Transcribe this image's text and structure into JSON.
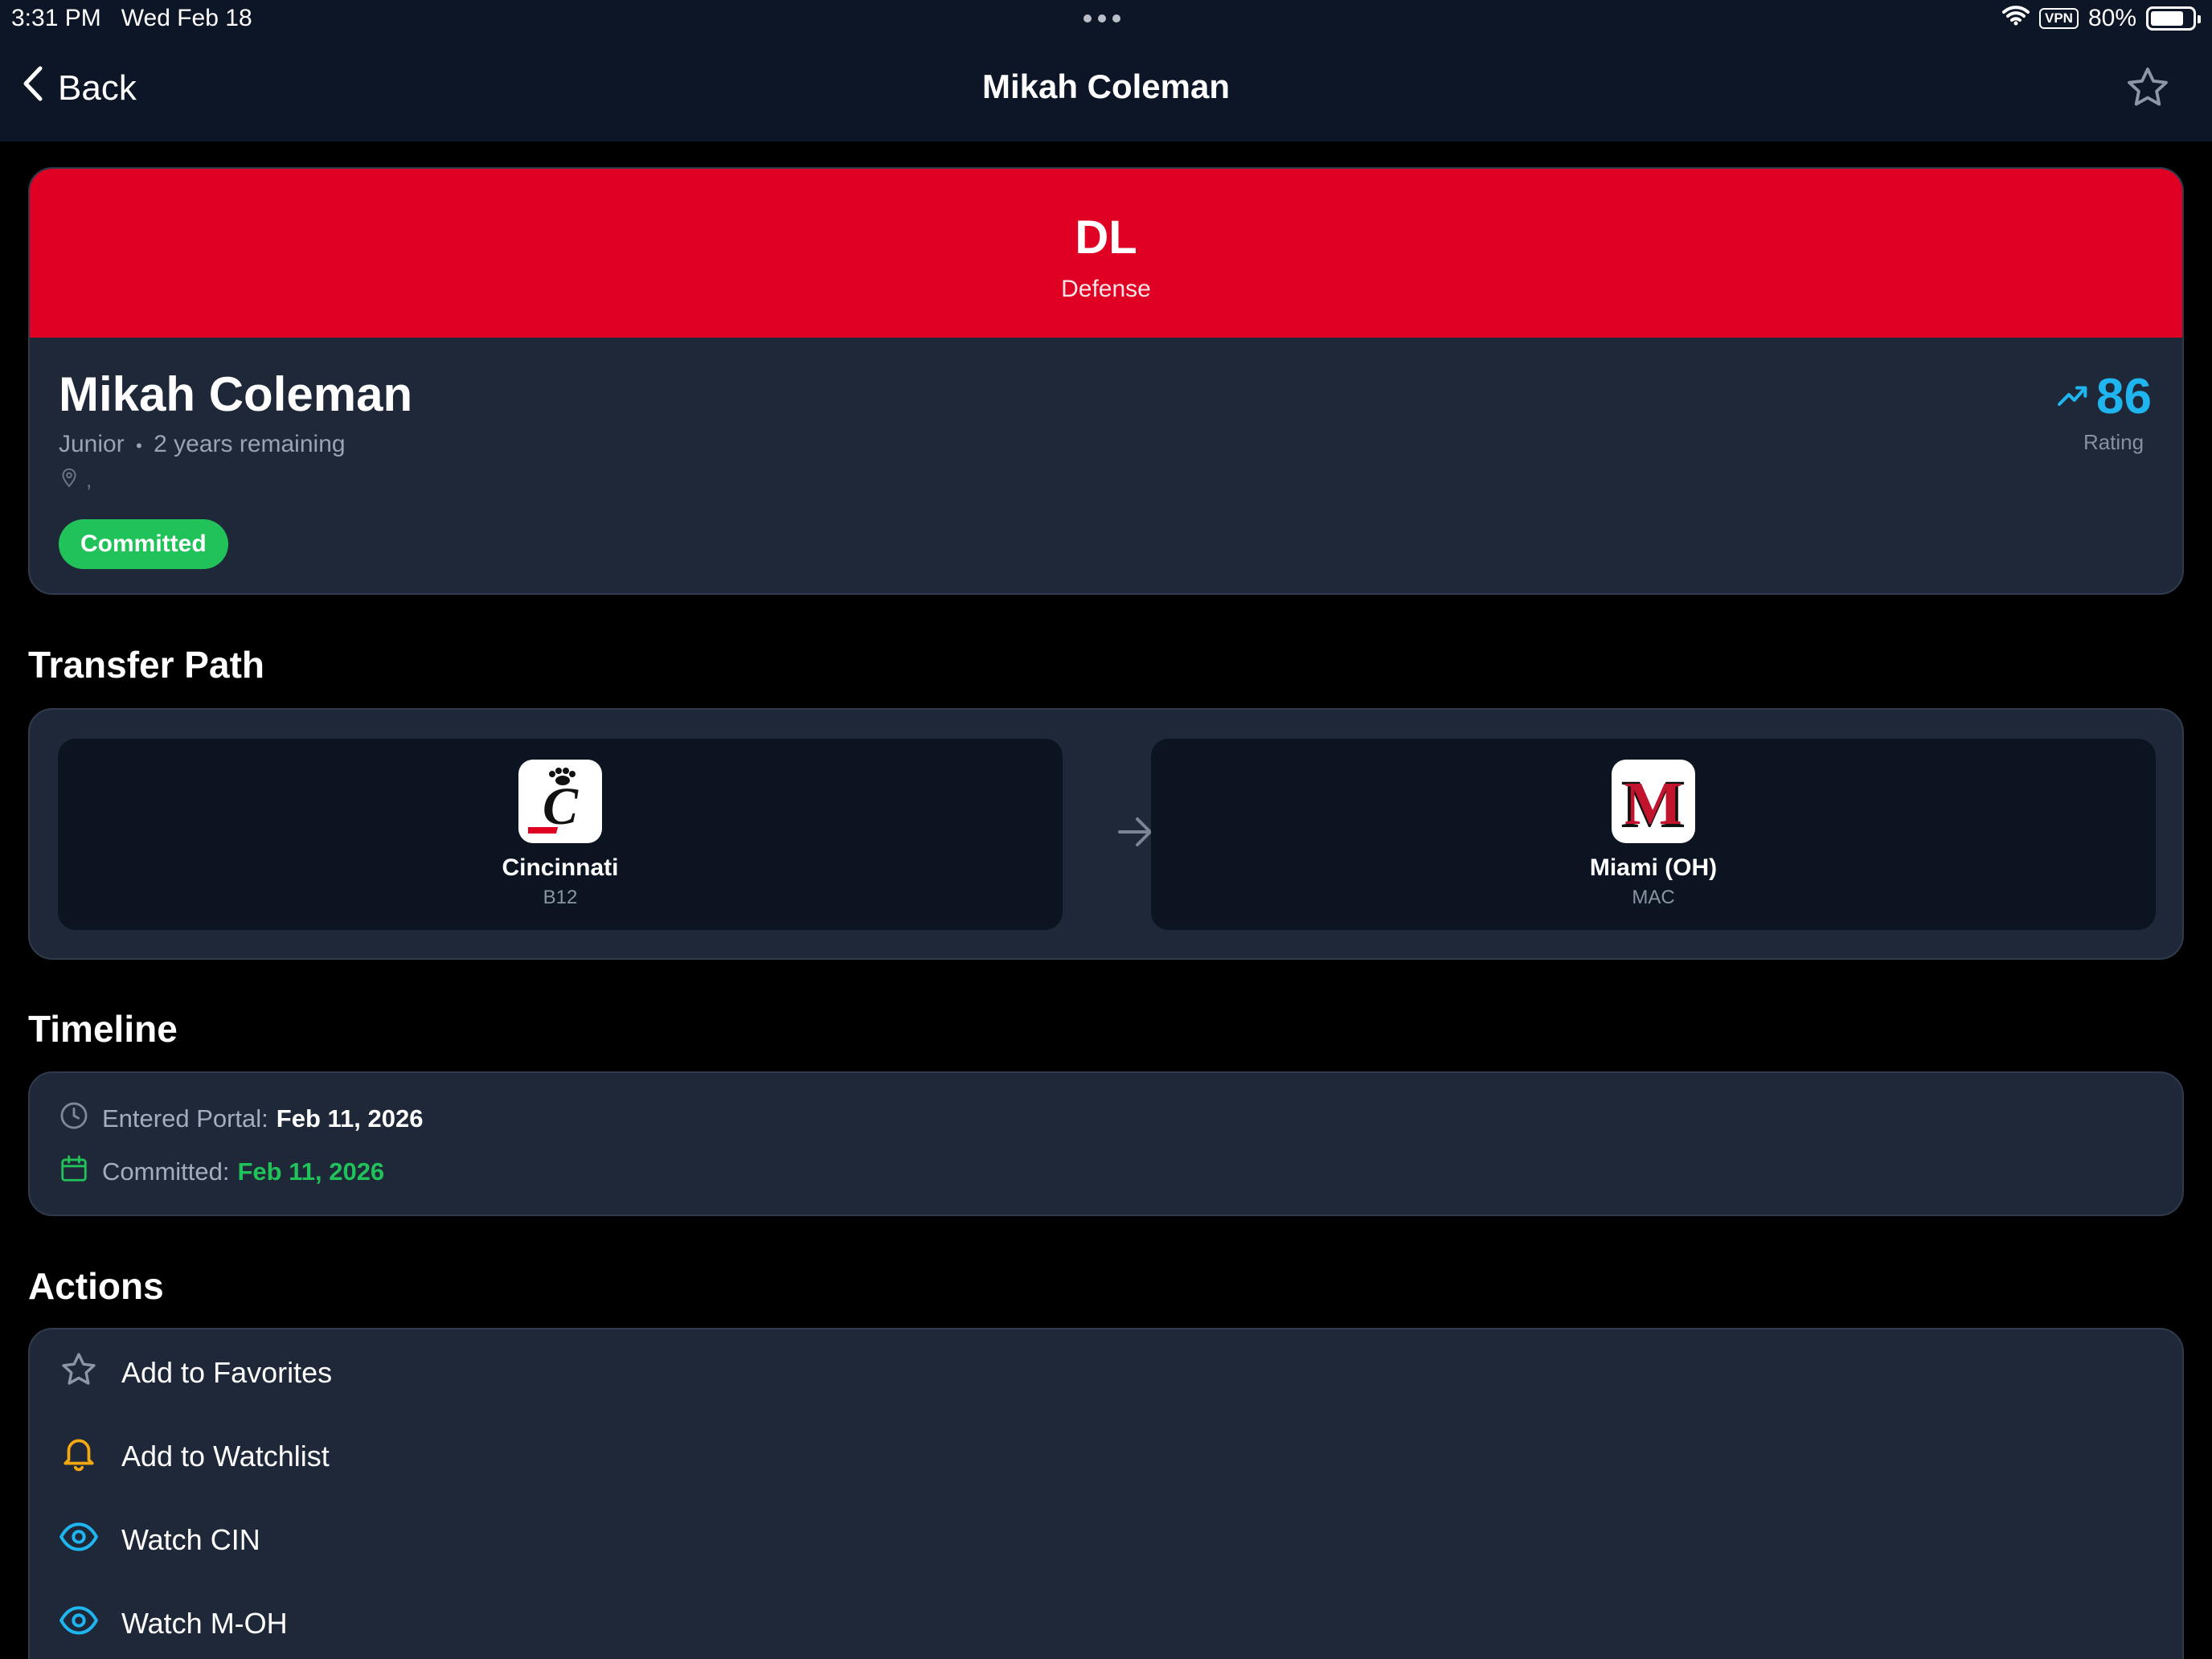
{
  "status_bar": {
    "time": "3:31 PM",
    "date": "Wed Feb 18",
    "vpn": "VPN",
    "battery": "80%",
    "battery_level": 0.8
  },
  "nav": {
    "back_label": "Back",
    "title": "Mikah Coleman"
  },
  "player": {
    "position_code": "DL",
    "position_group": "Defense",
    "name": "Mikah Coleman",
    "class_year": "Junior",
    "separator": "•",
    "eligibility": "2 years remaining",
    "location": ",",
    "status": "Committed",
    "rating": "86",
    "rating_label": "Rating"
  },
  "transfer_path": {
    "title": "Transfer Path",
    "from": {
      "name": "Cincinnati",
      "conference": "B12",
      "logo_letter": "C"
    },
    "to": {
      "name": "Miami (OH)",
      "conference": "MAC",
      "logo_letter": "M"
    }
  },
  "timeline": {
    "title": "Timeline",
    "entered_label": "Entered Portal:",
    "entered_date": "Feb 11, 2026",
    "committed_label": "Committed:",
    "committed_date": "Feb 11, 2026"
  },
  "actions": {
    "title": "Actions",
    "items": [
      {
        "label": "Add to Favorites",
        "icon": "star-icon"
      },
      {
        "label": "Add to Watchlist",
        "icon": "bell-icon"
      },
      {
        "label": "Watch CIN",
        "icon": "eye-icon"
      },
      {
        "label": "Watch M-OH",
        "icon": "eye-icon"
      }
    ]
  },
  "colors": {
    "position_banner": "#df0024",
    "committed_green": "#22c25a",
    "rating_blue": "#1fb6f0",
    "watchlist_orange": "#f3a712",
    "card_bg": "#1e2838"
  }
}
